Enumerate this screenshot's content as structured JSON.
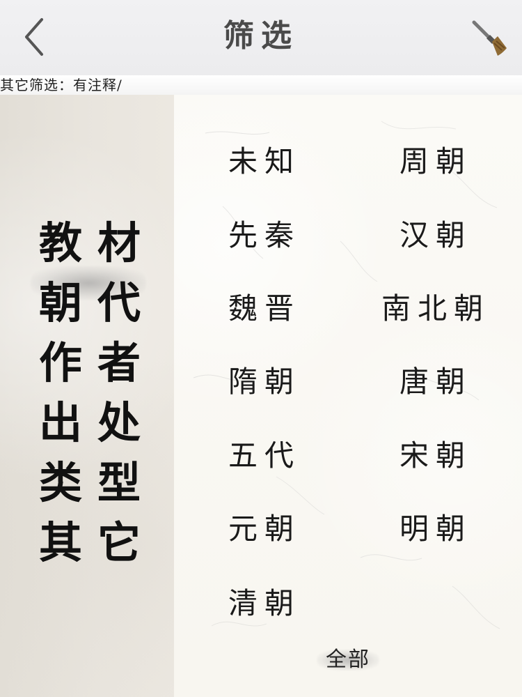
{
  "header": {
    "title": "筛选",
    "back_icon": "chevron-left-icon",
    "reset_icon": "broom-icon"
  },
  "filter_summary": "其它筛选：有注释/",
  "categories": [
    {
      "label_1": "教",
      "label_2": "材"
    },
    {
      "label_1": "朝",
      "label_2": "代"
    },
    {
      "label_1": "作",
      "label_2": "者"
    },
    {
      "label_1": "出",
      "label_2": "处"
    },
    {
      "label_1": "类",
      "label_2": "型"
    },
    {
      "label_1": "其",
      "label_2": "它"
    }
  ],
  "active_category": "朝代",
  "dynasties": [
    "未知",
    "周朝",
    "先秦",
    "汉朝",
    "魏晋",
    "南北朝",
    "隋朝",
    "唐朝",
    "五代",
    "宋朝",
    "元朝",
    "明朝",
    "清朝"
  ],
  "all_button": "全部",
  "colors": {
    "text": "#1a1a1a",
    "header_bg": "#eeeeef",
    "paper_bg": "#f8f6f0",
    "left_panel_bg": "#e8e4dd"
  }
}
